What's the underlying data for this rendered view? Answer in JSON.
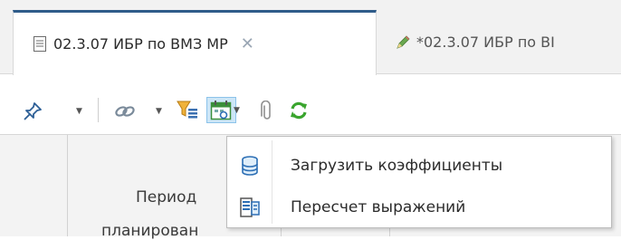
{
  "tabs": [
    {
      "label": "02.3.07 ИБР по ВМЗ МР",
      "close": "✕",
      "active": true
    },
    {
      "label": "*02.3.07 ИБР по ВІ",
      "active": false
    }
  ],
  "toolbar": {
    "dropdown_caret": "▼"
  },
  "grid": {
    "header_line1": "Период",
    "header_line2": "планирован"
  },
  "menu": {
    "items": [
      {
        "label": "Загрузить коэффициенты",
        "icon": "database-icon"
      },
      {
        "label": "Пересчет выражений",
        "icon": "recalculate-icon"
      }
    ]
  },
  "colors": {
    "active_tab_border": "#2f5c8a",
    "pressed_bg": "#cde6f7",
    "refresh_green": "#3aa52e"
  }
}
